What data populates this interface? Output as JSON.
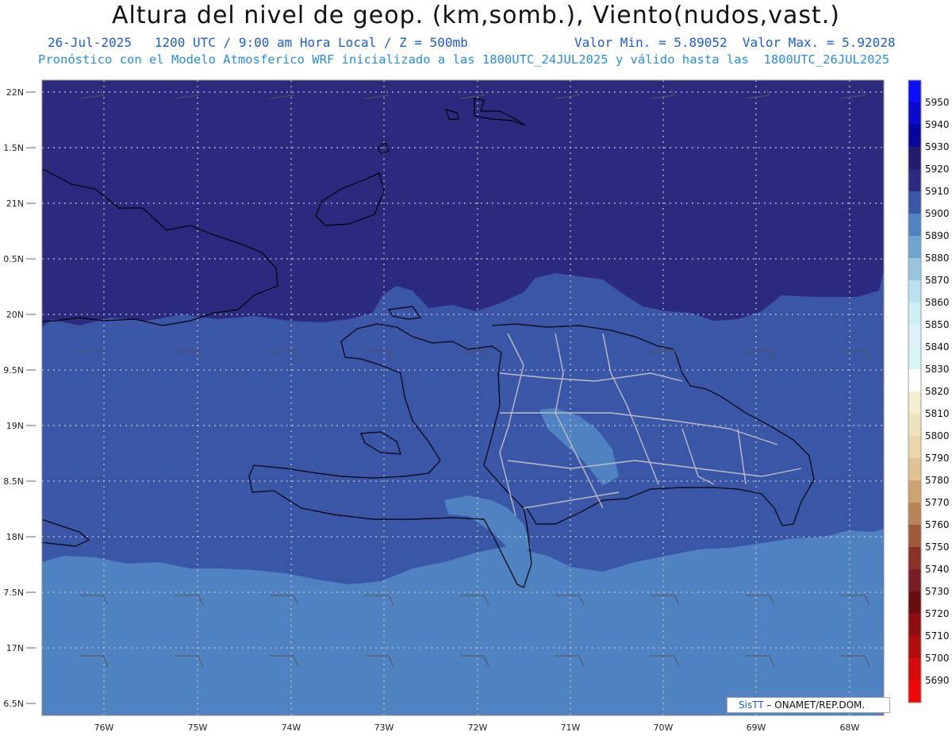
{
  "header": {
    "title": "Altura del nivel de geop. (km,somb.), Viento(nudos,vast.)",
    "line1_left": "26-Jul-2025   1200 UTC / 9:00 am Hora Local / Z = 500mb",
    "line1_right": "Valor Min. = 5.89052  Valor Max. = 5.92028",
    "line2": "Pronóstico con el Modelo Atmosferico WRF inicializado a las 1800UTC_24JUL2025 y válido hasta las  1800UTC_26JUL2025"
  },
  "axes": {
    "lat_labels": [
      "22N",
      "1.5N",
      "21N",
      "0.5N",
      "20N",
      "9.5N",
      "19N",
      "8.5N",
      "18N",
      "7.5N",
      "17N",
      "6.5N"
    ],
    "lon_labels": [
      "76W",
      "75W",
      "74W",
      "73W",
      "72W",
      "71W",
      "70W",
      "69W",
      "68W"
    ]
  },
  "colorbar": {
    "labels": [
      "5950",
      "5940",
      "5930",
      "5920",
      "5910",
      "5900",
      "5890",
      "5880",
      "5870",
      "5860",
      "5850",
      "5840",
      "5830",
      "5820",
      "5810",
      "5800",
      "5790",
      "5780",
      "5770",
      "5760",
      "5750",
      "5740",
      "5730",
      "5720",
      "5710",
      "5700",
      "5690"
    ],
    "colors": [
      "#0d0dff",
      "#0a0acf",
      "#06069c",
      "#231a6e",
      "#2b2a7e",
      "#3a56a6",
      "#4e82c0",
      "#6ea4cf",
      "#98c6df",
      "#b9e2ee",
      "#cceff4",
      "#dcf2f8",
      "#d6f5f7",
      "#ffffff",
      "#f6efcf",
      "#efe3bc",
      "#ead7a9",
      "#e0c293",
      "#cea36f",
      "#b98455",
      "#a05a3a",
      "#8a3228",
      "#7a1e25",
      "#6a0d10",
      "#8f0f10",
      "#b30c0c",
      "#d90a0a",
      "#f00808"
    ]
  },
  "map_layers": {
    "shading_colors": {
      "high": "#2b2a7e",
      "mid": "#3a56a6",
      "low": "#4e82c0",
      "lowest": "#6ea4cf"
    }
  },
  "credit": {
    "prefix": "SisTT",
    "text": " – ONAMET/REP.DOM."
  }
}
